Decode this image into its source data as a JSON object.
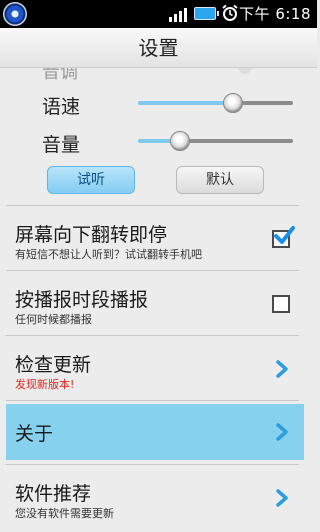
{
  "status_bar": {
    "time": "下午 6:18",
    "icons": [
      "app-icon",
      "signal-icon",
      "battery-icon",
      "alarm-icon"
    ]
  },
  "header": {
    "title": "设置"
  },
  "speech": {
    "partial_label": "音调",
    "speed": {
      "label": "语速",
      "value": 0.61
    },
    "volume": {
      "label": "音量",
      "value": 0.27
    },
    "try_button": "试听",
    "default_button": "默认"
  },
  "items": [
    {
      "title": "屏幕向下翻转即停",
      "subtitle": "有短信不想让人听到？试试翻转手机吧",
      "control": "checkbox",
      "checked": true
    },
    {
      "title": "按播报时段播报",
      "subtitle": "任何时候都播报",
      "control": "checkbox",
      "checked": false
    },
    {
      "title": "检查更新",
      "subtitle": "发现新版本!",
      "control": "chevron"
    },
    {
      "title": "关于",
      "subtitle": "",
      "control": "chevron",
      "highlighted": true
    },
    {
      "title": "软件推荐",
      "subtitle": "您没有软件需要更新",
      "control": "chevron"
    }
  ],
  "colors": {
    "accent": "#86d1ee",
    "track_active": "#7fc9ee",
    "track_inactive": "#8c8c8c",
    "checkmark": "#1a8ee8",
    "update_notice": "#e0241b",
    "chevron": "#2c9ee0"
  }
}
